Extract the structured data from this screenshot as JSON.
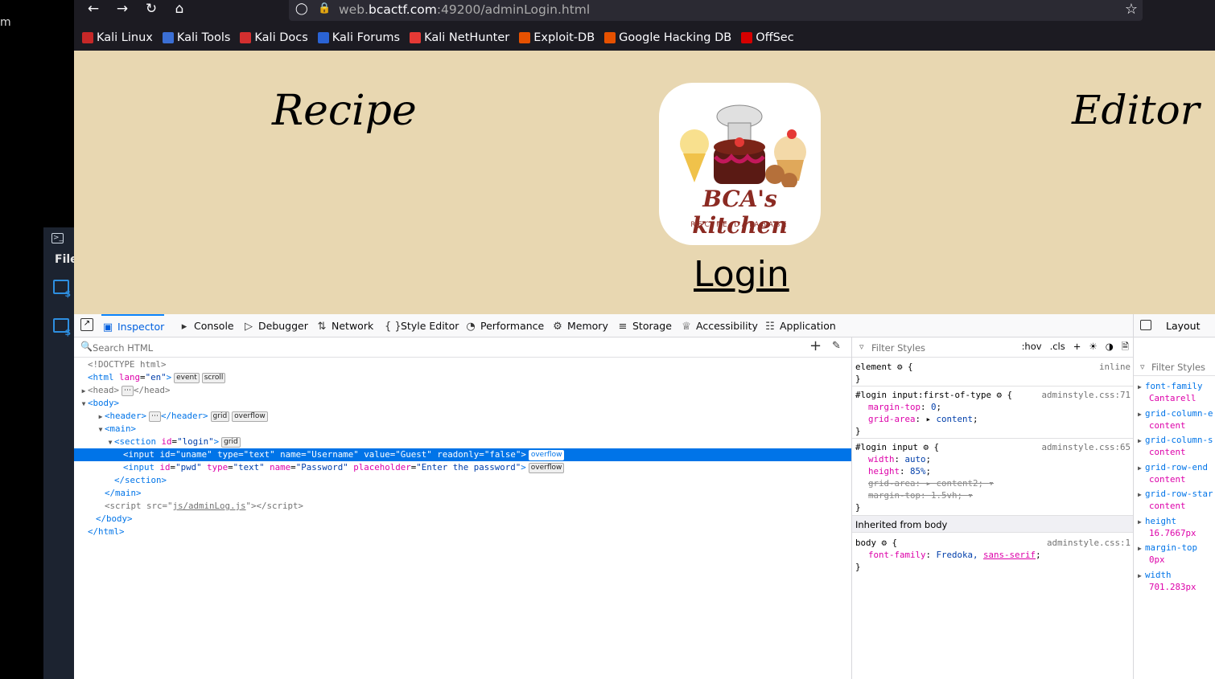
{
  "desktop": {
    "left_char": "m",
    "terminal_menu": "File"
  },
  "browser": {
    "url_prefix": "web.",
    "url_domain": "bcactf.com",
    "url_rest": ":49200/adminLogin.html",
    "bookmarks": [
      {
        "label": "Kali Linux",
        "color": "#c62828"
      },
      {
        "label": "Kali Tools",
        "color": "#3b6fd4"
      },
      {
        "label": "Kali Docs",
        "color": "#d32f2f"
      },
      {
        "label": "Kali Forums",
        "color": "#2a63d4"
      },
      {
        "label": "Kali NetHunter",
        "color": "#e53935"
      },
      {
        "label": "Exploit-DB",
        "color": "#e65100"
      },
      {
        "label": "Google Hacking DB",
        "color": "#e65100"
      },
      {
        "label": "OffSec",
        "color": "#d50000"
      }
    ]
  },
  "page": {
    "left_word": "Recipe",
    "right_word": "Editor",
    "logo_title": "BCA's kitchen",
    "logo_subtitle": "RECIPE DATABASE",
    "heading": "Login"
  },
  "devtools": {
    "tabs": [
      "Inspector",
      "Console",
      "Debugger",
      "Network",
      "Style Editor",
      "Performance",
      "Memory",
      "Storage",
      "Accessibility",
      "Application"
    ],
    "search_placeholder": "Search HTML",
    "filter_placeholder": "Filter Styles",
    "hov": ":hov",
    "cls": ".cls",
    "layout_tab": "Layout",
    "inherited_label": "Inherited from body",
    "rules": {
      "element_sel": "element",
      "element_src": "inline",
      "r1_sel": "#login input:first-of-type",
      "r1_src": "adminstyle.css:71",
      "r2_sel": "#login input",
      "r2_src": "adminstyle.css:65",
      "r3_sel": "body",
      "r3_src": "adminstyle.css:1"
    },
    "layout_props": [
      {
        "k": "font-family",
        "v": "Cantarell"
      },
      {
        "k": "grid-column-e",
        "v": "content"
      },
      {
        "k": "grid-column-s",
        "v": "content"
      },
      {
        "k": "grid-row-end",
        "v": "content"
      },
      {
        "k": "grid-row-star",
        "v": "content"
      },
      {
        "k": "height",
        "v": "16.7667px"
      },
      {
        "k": "margin-top",
        "v": "0px"
      },
      {
        "k": "width",
        "v": "701.283px"
      }
    ]
  }
}
